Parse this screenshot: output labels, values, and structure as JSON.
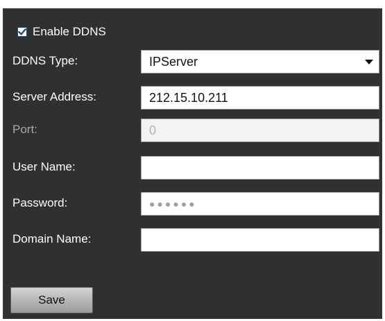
{
  "ddns": {
    "enable": {
      "label": "Enable DDNS",
      "checked": true
    },
    "type": {
      "label": "DDNS Type:",
      "value": "IPServer"
    },
    "server_address": {
      "label": "Server Address:",
      "value": "212.15.10.211"
    },
    "port": {
      "label": "Port:",
      "value": "0",
      "disabled": true
    },
    "user_name": {
      "label": "User Name:",
      "value": ""
    },
    "password": {
      "label": "Password:",
      "masked_value": "●●●●●●"
    },
    "domain_name": {
      "label": "Domain Name:",
      "value": ""
    }
  },
  "actions": {
    "save_label": "Save"
  },
  "icons": {
    "checkbox": "checkmark-icon",
    "dropdown": "caret-down-icon"
  },
  "colors": {
    "panel_bg": "#2f3030",
    "field_bg": "#ffffff",
    "disabled_text": "#b3b3b3",
    "check_mark": "#1e4a8a"
  }
}
